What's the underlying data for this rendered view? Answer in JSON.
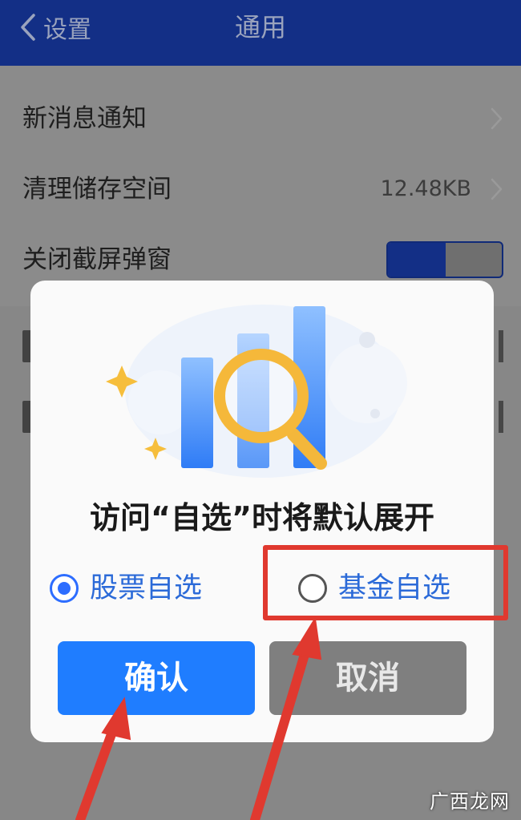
{
  "navbar": {
    "back_label": "设置",
    "title": "通用"
  },
  "settings": {
    "rows": [
      {
        "label": "新消息通知",
        "value": ""
      },
      {
        "label": "清理储存空间",
        "value": "12.48KB"
      },
      {
        "label": "关闭截屏弹窗",
        "value": ""
      }
    ]
  },
  "dialog": {
    "title": "访问“自选”时将默认展开",
    "options": [
      {
        "label": "股票自选",
        "selected": true
      },
      {
        "label": "基金自选",
        "selected": false
      }
    ],
    "confirm_label": "确认",
    "cancel_label": "取消"
  },
  "watermark": {
    "text": "广西龙网"
  },
  "colors": {
    "navbar": "#132f86",
    "accent_blue": "#1f7dff",
    "annotation_red": "#e0392f",
    "cancel_gray": "#7f7f7f"
  }
}
